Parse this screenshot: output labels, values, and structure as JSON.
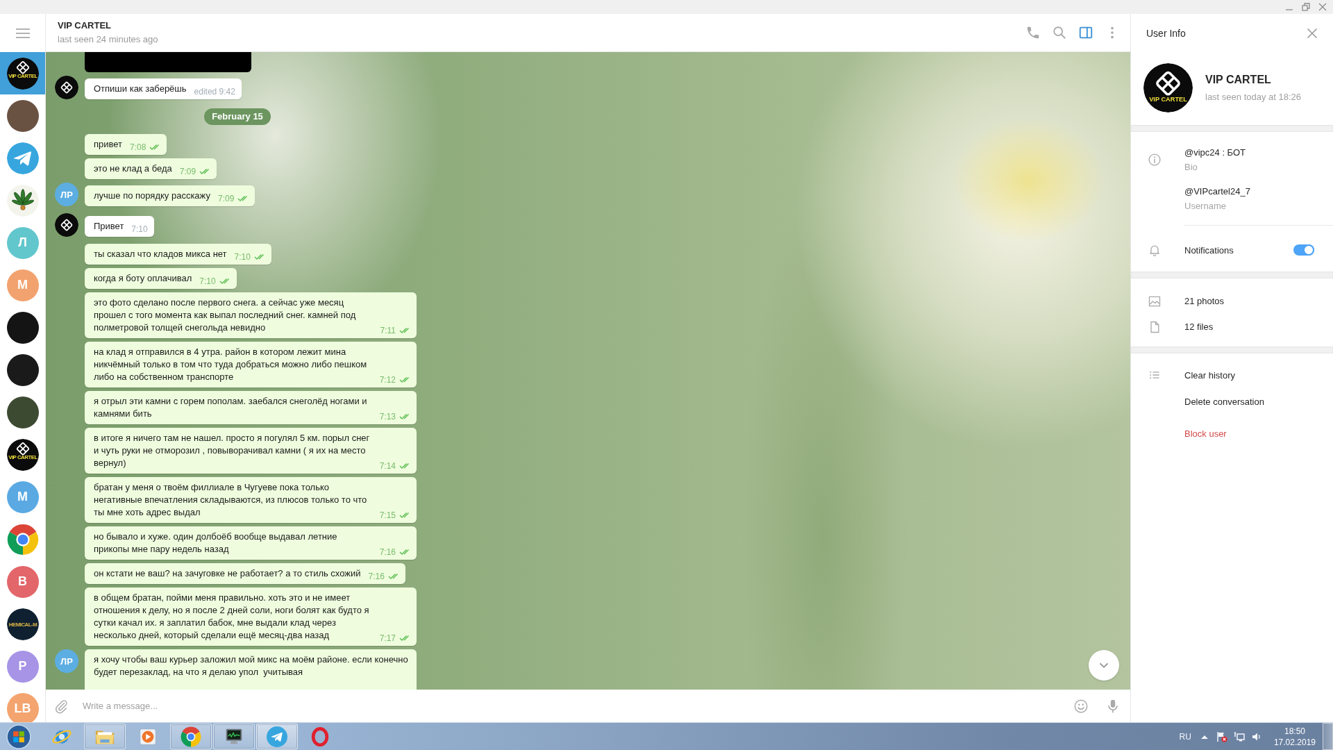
{
  "sidebar": {
    "chats": [
      {
        "kind": "logo",
        "logo_text": "VIP CARTEL",
        "selected": true
      },
      {
        "kind": "photo",
        "color": "#6a5243",
        "selected": false
      },
      {
        "kind": "plane",
        "selected": false
      },
      {
        "kind": "leaf",
        "selected": false
      },
      {
        "kind": "initials",
        "initials": "Л",
        "color": "#62c6cd",
        "selected": false
      },
      {
        "kind": "initials",
        "initials": "М",
        "color": "#f2a26f",
        "selected": false
      },
      {
        "kind": "photo",
        "color": "#141414",
        "selected": false
      },
      {
        "kind": "photo",
        "color": "#1a1a1a",
        "selected": false
      },
      {
        "kind": "photo",
        "color": "#3d4a32",
        "selected": false
      },
      {
        "kind": "logo",
        "logo_text": "VIP CARTEL",
        "selected": false
      },
      {
        "kind": "initials",
        "initials": "М",
        "color": "#5aa9e2",
        "selected": false
      },
      {
        "kind": "rings",
        "selected": false
      },
      {
        "kind": "initials",
        "initials": "В",
        "color": "#e2666a",
        "selected": false
      },
      {
        "kind": "banner",
        "logo_text": "HEMICAL-M",
        "selected": false
      },
      {
        "kind": "initials",
        "initials": "Р",
        "color": "#a794e6",
        "selected": false
      },
      {
        "kind": "initials",
        "initials": "LB",
        "color": "#f4a46e",
        "selected": false
      }
    ]
  },
  "chat": {
    "title": "VIP CARTEL",
    "status": "last seen 24 minutes ago",
    "panel_button": {
      "on": true
    },
    "messages": [
      {
        "kind": "photo"
      },
      {
        "kind": "text",
        "out": false,
        "avatar": {
          "kind": "logo"
        },
        "text": "Отпиши как заберёшь",
        "time": "edited 9:42"
      },
      {
        "kind": "date",
        "text": "February 15"
      },
      {
        "kind": "text",
        "out": true,
        "text": "привет",
        "time": "7:08"
      },
      {
        "kind": "text",
        "out": true,
        "text": "это не клад а беда",
        "time": "7:09"
      },
      {
        "kind": "text",
        "out": true,
        "avatar": {
          "kind": "initials",
          "initials": "ЛР",
          "color": "#5caee2"
        },
        "text": "лучше по порядку расскажу",
        "time": "7:09"
      },
      {
        "kind": "text",
        "out": false,
        "avatar": {
          "kind": "logo"
        },
        "text": "Привет",
        "time": "7:10"
      },
      {
        "kind": "text",
        "out": true,
        "text": "ты сказал что кладов микса нет",
        "time": "7:10"
      },
      {
        "kind": "text",
        "out": true,
        "text": "когда я боту оплачивал",
        "time": "7:10"
      },
      {
        "kind": "text",
        "out": true,
        "text": "это фото сделано после первого снега. а сейчас уже месяц прошел с того момента как выпал последний снег. камней под полметровой толщей снегольда невидно",
        "time": "7:11"
      },
      {
        "kind": "text",
        "out": true,
        "text": "на клад я отправился в 4 утра. район в котором лежит мина никчёмный только в том что туда добраться можно либо пешком либо на собственном транспорте",
        "time": "7:12"
      },
      {
        "kind": "text",
        "out": true,
        "text": "я отрыл эти камни с горем пополам. заебался снеголёд ногами и камнями бить",
        "time": "7:13"
      },
      {
        "kind": "text",
        "out": true,
        "text": "в итоге я ничего там не нашел. просто я погулял 5 км. порыл снег и чуть руки не отморозил , повыворачивал камни ( я их на место вернул)",
        "time": "7:14"
      },
      {
        "kind": "text",
        "out": true,
        "text": "братан у меня о твоём филлиале в Чугуеве пока только негативные впечатления складываются, из плюсов только то что ты мне хоть адрес выдал",
        "time": "7:15"
      },
      {
        "kind": "text",
        "out": true,
        "text": "но бывало и хуже. один долбоёб вообще выдавал летние прикопы мне пару недель назад",
        "time": "7:16"
      },
      {
        "kind": "text",
        "out": true,
        "text": "он кстати не ваш? на зачуговке не работает? а то стиль схожий",
        "time": "7:16"
      },
      {
        "kind": "text",
        "out": true,
        "text": "в общем братан, пойми меня правильно. хоть это и не имеет отношения к делу, но я после 2 дней соли, ноги болят как будто я сутки качал их. я заплатил бабок, мне выдали клад через несколько дней, который сделали ещё месяц-два назад",
        "time": "7:17"
      },
      {
        "kind": "text",
        "out": true,
        "avatar": {
          "kind": "initials",
          "initials": "ЛР",
          "color": "#5caee2"
        },
        "text": "я хочу чтобы ваш курьер заложил мой микс на моём районе. если конечно будет перезаклад, на что я делаю упол  учитывая"
      }
    ],
    "composer": {
      "placeholder": "Write a message..."
    }
  },
  "profile": {
    "title": "User Info",
    "name": "VIP CARTEL",
    "status": "last seen today at 18:26",
    "avatar": {
      "logo_text": "VIP CARTEL"
    },
    "fields": [
      {
        "value": "@vipc24 : БОТ",
        "label": "Bio"
      },
      {
        "value": "@VIPcartel24_7",
        "label": "Username"
      }
    ],
    "notifications": {
      "label": "Notifications",
      "on": true
    },
    "media": [
      {
        "kind": "photos",
        "label": "21 photos"
      },
      {
        "kind": "files",
        "label": "12 files"
      }
    ],
    "actions": [
      {
        "kind": "clear",
        "label": "Clear history"
      },
      {
        "kind": "delete",
        "label": "Delete conversation"
      },
      {
        "kind": "block",
        "label": "Block user"
      }
    ]
  },
  "taskbar": {
    "apps": [
      {
        "kind": "ie",
        "open": false,
        "active": false
      },
      {
        "kind": "folder",
        "open": true,
        "active": false
      },
      {
        "kind": "player",
        "open": false,
        "active": false
      },
      {
        "kind": "chrome",
        "open": true,
        "active": false
      },
      {
        "kind": "monitor",
        "open": true,
        "active": false
      },
      {
        "kind": "telegram",
        "open": true,
        "active": true
      },
      {
        "kind": "opera",
        "open": false,
        "active": false
      }
    ],
    "tray": {
      "language": "RU",
      "time": "18:50",
      "date": "17.02.2019"
    }
  }
}
